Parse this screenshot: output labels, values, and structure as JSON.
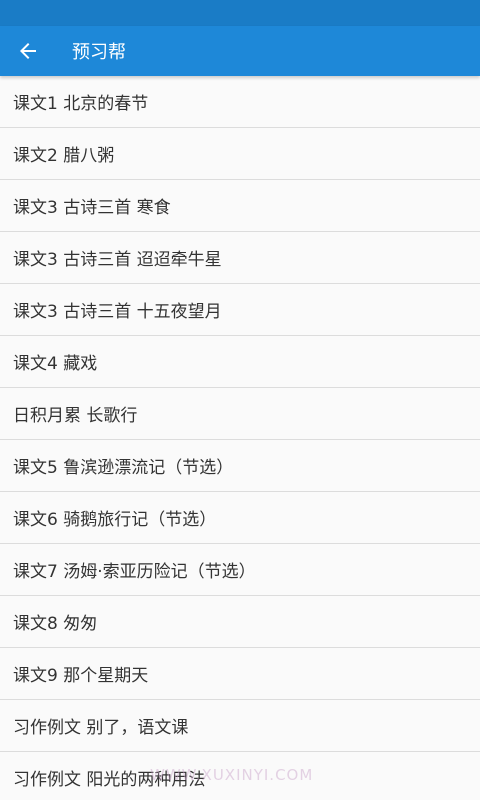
{
  "app_bar": {
    "title": "预习帮",
    "back_icon": "arrow-left-icon"
  },
  "colors": {
    "status_bar": "#1a7cc6",
    "app_bar": "#1e88d8",
    "list_background": "#fafafa",
    "divider": "#dcdcdc",
    "text": "#333333"
  },
  "lessons": [
    {
      "label": "课文1 北京的春节"
    },
    {
      "label": "课文2 腊八粥"
    },
    {
      "label": "课文3 古诗三首 寒食"
    },
    {
      "label": "课文3 古诗三首 迢迢牵牛星"
    },
    {
      "label": "课文3 古诗三首 十五夜望月"
    },
    {
      "label": "课文4 藏戏"
    },
    {
      "label": "日积月累 长歌行"
    },
    {
      "label": "课文5 鲁滨逊漂流记（节选）"
    },
    {
      "label": "课文6 骑鹅旅行记（节选）"
    },
    {
      "label": "课文7 汤姆·索亚历险记（节选）"
    },
    {
      "label": "课文8 匆匆"
    },
    {
      "label": "课文9 那个星期天"
    },
    {
      "label": "习作例文 别了，语文课"
    },
    {
      "label": "习作例文 阳光的两种用法"
    }
  ],
  "watermark": {
    "text": "WWW.XUXINYI.COM"
  }
}
